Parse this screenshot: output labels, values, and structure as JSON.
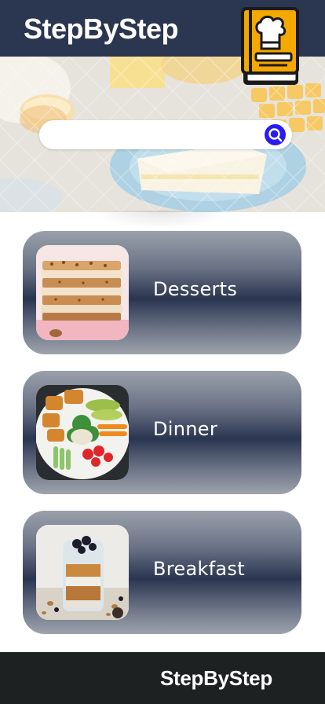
{
  "app": {
    "title": "StepByStep"
  },
  "search": {
    "value": "",
    "placeholder": ""
  },
  "icons": {
    "logo": "chef-cookbook-icon",
    "search": "search-icon"
  },
  "colors": {
    "header": "#2b3650",
    "footer": "#1e2122",
    "search_button": "#2a1cf0",
    "logo_book": "#f5a800"
  },
  "categories": [
    {
      "label": "Desserts",
      "image": "layered-cake-slice"
    },
    {
      "label": "Dinner",
      "image": "salad-plate"
    },
    {
      "label": "Breakfast",
      "image": "granola-jar"
    }
  ],
  "footer": {
    "brand": "StepByStep"
  }
}
